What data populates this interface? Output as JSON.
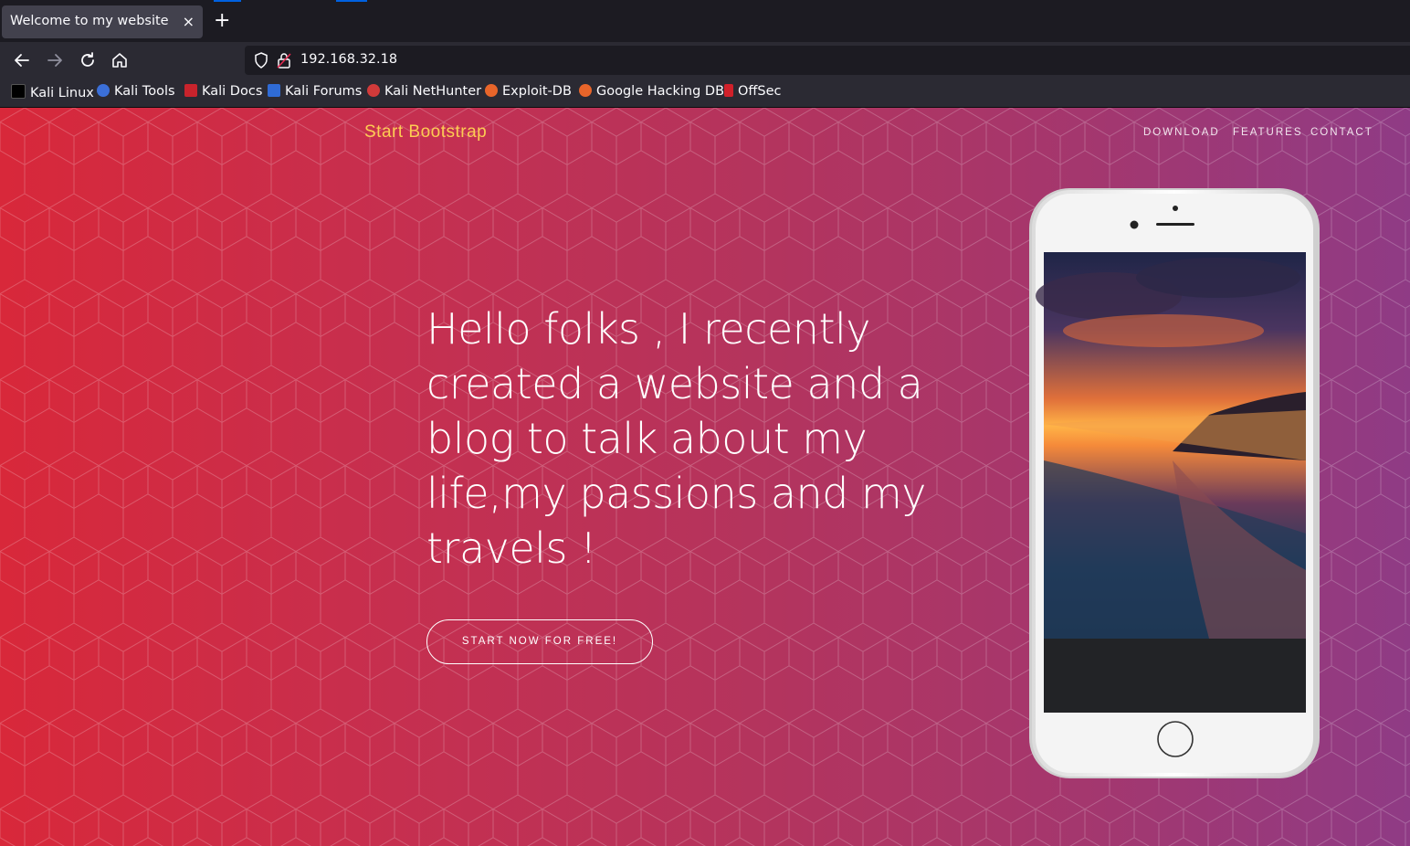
{
  "browser": {
    "tab": {
      "title": "Welcome to my website",
      "close": "×"
    },
    "new_tab": "+",
    "url": "192.168.32.18",
    "bookmarks": [
      {
        "label": "Kali Linux",
        "icon": "kali-dragon-icon"
      },
      {
        "label": "Kali Tools",
        "icon": "kali-tools-icon"
      },
      {
        "label": "Kali Docs",
        "icon": "kali-docs-icon"
      },
      {
        "label": "Kali Forums",
        "icon": "kali-forums-icon"
      },
      {
        "label": "Kali NetHunter",
        "icon": "nethunter-icon"
      },
      {
        "label": "Exploit-DB",
        "icon": "exploit-db-icon"
      },
      {
        "label": "Google Hacking DB",
        "icon": "ghdb-icon"
      },
      {
        "label": "OffSec",
        "icon": "offsec-icon"
      }
    ]
  },
  "site": {
    "brand": "Start Bootstrap",
    "nav": [
      "DOWNLOAD",
      "FEATURES",
      "CONTACT"
    ],
    "headline_lines": [
      "Hello folks , I recently",
      "created a website and a",
      "blog to talk about my",
      "life,my passions and my",
      "travels !"
    ],
    "cta": "START NOW FOR FREE!"
  },
  "colors": {
    "brand": "#fdcc52",
    "gradient_left": "#d8283a",
    "gradient_right": "#8f3b85",
    "chrome_dark": "#1c1b22",
    "chrome_mid": "#2b2a33"
  }
}
